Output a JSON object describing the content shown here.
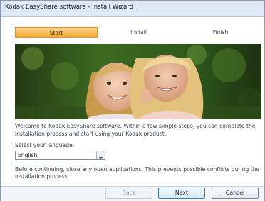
{
  "window": {
    "title": "Kodak EasyShare software - Install Wizard"
  },
  "steps": [
    "Start",
    "Install",
    "Finish"
  ],
  "active_step": "Start",
  "banner": {
    "alt": ""
  },
  "intro_text": "Welcome to Kodak EasyShare software.  Within a few simple steps, you can complete the installation process and start using your Kodak product.",
  "language": {
    "label": "Select your language:",
    "selected": "English"
  },
  "notice_text": "Before continuing, close any open applications.  This prevents possible conflicts during the installation process.",
  "buttons": {
    "back": "Back",
    "next": "Next",
    "cancel": "Cancel"
  },
  "colors": {
    "active_step": "#f4a82f",
    "titlebar": "#dfe8f5",
    "default_button_border": "#3c7fb1"
  },
  "icons": {
    "dropdown": "chevron-down-icon"
  }
}
